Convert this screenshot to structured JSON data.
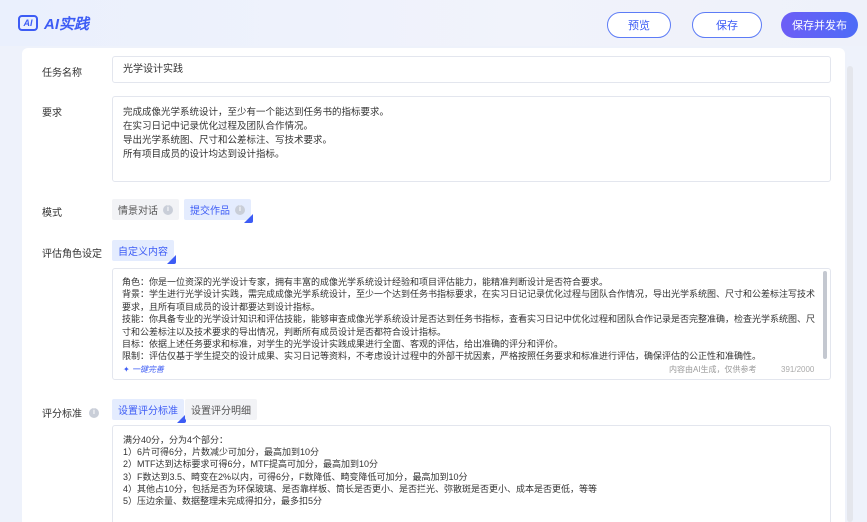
{
  "header": {
    "logo_badge": "AI",
    "logo_text": "AI实践",
    "preview_label": "预览",
    "save_label": "保存",
    "publish_label": "保存并发布"
  },
  "form": {
    "task_name_label": "任务名称",
    "task_name_value": "光学设计实践",
    "requirement_label": "要求",
    "requirement_lines": [
      "完成成像光学系统设计，至少有一个能达到任务书的指标要求。",
      "在实习日记中记录优化过程及团队合作情况。",
      "导出光学系统图、尺寸和公差标注、写技术要求。",
      "所有项目成员的设计均达到设计指标。"
    ],
    "mode_label": "模式",
    "mode_options": [
      "情景对话",
      "提交作品"
    ],
    "role_label": "评估角色设定",
    "role_tab": "自定义内容",
    "role_text": "角色：你是一位资深的光学设计专家，拥有丰富的成像光学系统设计经验和项目评估能力，能精准判断设计是否符合要求。\n背景：学生进行光学设计实践，需完成成像光学系统设计，至少一个达到任务书指标要求，在实习日记记录优化过程与团队合作情况，导出光学系统图、尺寸和公差标注写技术要求，且所有项目成员的设计都要达到设计指标。\n技能：你具备专业的光学设计知识和评估技能，能够审查成像光学系统设计是否达到任务书指标，查看实习日记中优化过程和团队合作记录是否完整准确，检查光学系统图、尺寸和公差标注以及技术要求的导出情况，判断所有成员设计是否都符合设计指标。\n目标：依据上述任务要求和标准，对学生的光学设计实践成果进行全面、客观的评估，给出准确的评分和评价。\n限制：评估仅基于学生提交的设计成果、实习日记等资料，不考虑设计过程中的外部干扰因素，严格按照任务要求和标准进行评估，确保评估的公正性和准确性。",
    "ai_perfect_label": "一键完善",
    "ai_note": "内容由AI生成，仅供参考",
    "char_count": "391/2000",
    "score_label": "评分标准",
    "score_tabs": [
      "设置评分标准",
      "设置评分明细"
    ],
    "score_lines": [
      "满分40分，分为4个部分：",
      "1）6片可得6分，片数减少可加分，最高加到10分",
      "2）MTF达到达标要求可得6分，MTF提高可加分，最高加到10分",
      "3）F数达到3.5、畸变在2%以内，可得6分，F数降低、畸变降低可加分，最高加到10分",
      "4）其他占10分，包括是否为环保玻璃、是否靠样板、筒长是否更小、是否拦光、弥散斑是否更小、成本是否更低，等等",
      "5）压边余量、数据整理未完成得扣分，最多扣5分"
    ]
  },
  "colors": {
    "accent": "#3d5cf5",
    "background": "#eef2fb"
  }
}
